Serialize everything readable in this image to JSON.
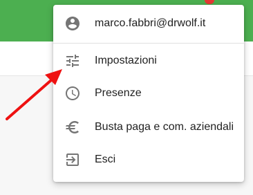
{
  "appbar": {
    "color": "#4caf50",
    "notification_dot_color": "#e53935"
  },
  "menu": {
    "account": {
      "email": "marco.fabbri@drwolf.it",
      "icon": "account-circle-icon"
    },
    "items": [
      {
        "label": "Impostazioni",
        "icon": "settings-sliders-icon"
      },
      {
        "label": "Presenze",
        "icon": "clock-icon"
      },
      {
        "label": "Busta paga e com. aziendali",
        "icon": "euro-icon"
      },
      {
        "label": "Esci",
        "icon": "logout-icon"
      }
    ]
  },
  "annotation": {
    "type": "arrow",
    "color": "#ee1111",
    "points_to": "Impostazioni"
  }
}
